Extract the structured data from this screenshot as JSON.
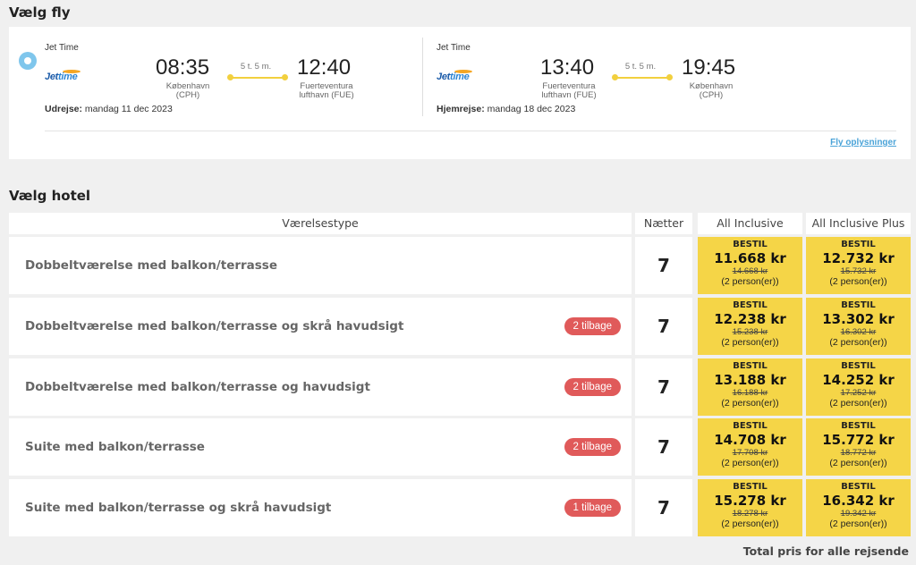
{
  "sections": {
    "flights_title": "Vælg fly",
    "hotel_title": "Vælg hotel"
  },
  "flights": {
    "outbound": {
      "airline": "Jet Time",
      "logo": {
        "part1": "Jet",
        "part2": "time"
      },
      "depart_time": "08:35",
      "depart_city": "København",
      "depart_code": "(CPH)",
      "duration": "5 t. 5 m.",
      "arrive_time": "12:40",
      "arrive_city": "Fuerteventura",
      "arrive_code": "lufthavn (FUE)",
      "date_label": "Udrejse:",
      "date_value": " mandag 11 dec 2023"
    },
    "return": {
      "airline": "Jet Time",
      "logo": {
        "part1": "Jet",
        "part2": "time"
      },
      "depart_time": "13:40",
      "depart_city": "Fuerteventura",
      "depart_code": "lufthavn (FUE)",
      "duration": "5 t. 5 m.",
      "arrive_time": "19:45",
      "arrive_city": "København",
      "arrive_code": "(CPH)",
      "date_label": "Hjemrejse:",
      "date_value": " mandag 18 dec 2023"
    },
    "info_link": "Fly oplysninger"
  },
  "hotel": {
    "headers": {
      "room_type": "Værelsestype",
      "nights": "Nætter",
      "col1": "All Inclusive",
      "col2": "All Inclusive Plus"
    },
    "rows": [
      {
        "room": "Dobbeltværelse med balkon/terrasse",
        "badge": "",
        "nights": "7",
        "p1": {
          "label": "BESTIL",
          "price": "11.668 kr",
          "old": "14.668 kr",
          "persons": "(2 person(er))"
        },
        "p2": {
          "label": "BESTIL",
          "price": "12.732 kr",
          "old": "15.732 kr",
          "persons": "(2 person(er))"
        }
      },
      {
        "room": "Dobbeltværelse med balkon/terrasse og skrå havudsigt",
        "badge": "2 tilbage",
        "nights": "7",
        "p1": {
          "label": "BESTIL",
          "price": "12.238 kr",
          "old": "15.238 kr",
          "persons": "(2 person(er))"
        },
        "p2": {
          "label": "BESTIL",
          "price": "13.302 kr",
          "old": "16.302 kr",
          "persons": "(2 person(er))"
        }
      },
      {
        "room": "Dobbeltværelse med balkon/terrasse og havudsigt",
        "badge": "2 tilbage",
        "nights": "7",
        "p1": {
          "label": "BESTIL",
          "price": "13.188 kr",
          "old": "16.188 kr",
          "persons": "(2 person(er))"
        },
        "p2": {
          "label": "BESTIL",
          "price": "14.252 kr",
          "old": "17.252 kr",
          "persons": "(2 person(er))"
        }
      },
      {
        "room": "Suite med balkon/terrasse",
        "badge": "2 tilbage",
        "nights": "7",
        "p1": {
          "label": "BESTIL",
          "price": "14.708 kr",
          "old": "17.708 kr",
          "persons": "(2 person(er))"
        },
        "p2": {
          "label": "BESTIL",
          "price": "15.772 kr",
          "old": "18.772 kr",
          "persons": "(2 person(er))"
        }
      },
      {
        "room": "Suite med balkon/terrasse og skrå havudsigt",
        "badge": "1 tilbage",
        "nights": "7",
        "p1": {
          "label": "BESTIL",
          "price": "15.278 kr",
          "old": "18.278 kr",
          "persons": "(2 person(er))"
        },
        "p2": {
          "label": "BESTIL",
          "price": "16.342 kr",
          "old": "19.342 kr",
          "persons": "(2 person(er))"
        }
      }
    ]
  },
  "footer": {
    "total_label": "Total pris for alle rejsende"
  },
  "colors": {
    "accent_yellow": "#f5d547",
    "badge_red": "#e05a5a",
    "link_blue": "#4aa3d8",
    "radio_blue": "#7fc6ec"
  },
  "icons": {
    "radio": "radio-selected-icon",
    "airline_logo": "jettime-logo-icon"
  }
}
